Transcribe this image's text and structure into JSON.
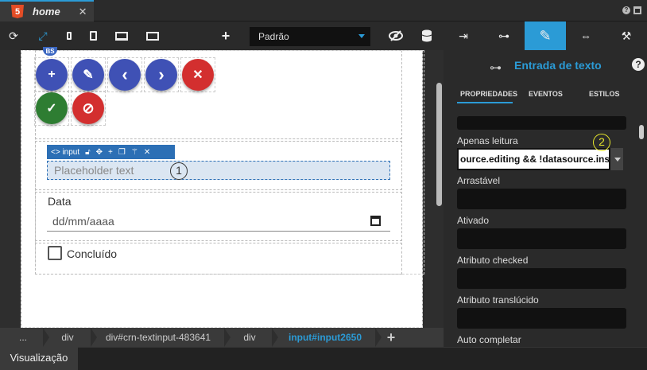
{
  "tab": {
    "title": "home",
    "icon": "html5-icon",
    "close": "✕"
  },
  "window": {
    "help": "?"
  },
  "toolbar": {
    "icons": [
      "refresh-icon",
      "expand-icon",
      "phone-icon",
      "tablet-icon",
      "desktop-icon",
      "monitor-icon",
      "plus-icon",
      "eye-slash-icon",
      "database-icon"
    ],
    "breakpoint_selected": "Padrão",
    "add_label": "+"
  },
  "canvas": {
    "bs_badge": "BS",
    "fab_buttons": [
      {
        "icon": "plus-icon",
        "glyph": "+",
        "color": "#3f51b5"
      },
      {
        "icon": "pencil-icon",
        "glyph": "✎",
        "color": "#3f51b5"
      },
      {
        "icon": "chevron-left-icon",
        "glyph": "‹",
        "color": "#3f51b5"
      },
      {
        "icon": "chevron-right-icon",
        "glyph": "›",
        "color": "#3f51b5"
      },
      {
        "icon": "close-icon",
        "glyph": "✕",
        "color": "#d32f2f"
      },
      {
        "icon": "check-icon",
        "glyph": "✓",
        "color": "#2e7d32"
      },
      {
        "icon": "block-icon",
        "glyph": "⊘",
        "color": "#d32f2f"
      }
    ],
    "input_toolbar": {
      "label": "<> input",
      "icons": [
        "unlock-icon",
        "move-icon",
        "add-icon",
        "copy-icon",
        "magic-icon",
        "remove-icon"
      ]
    },
    "text_input_placeholder": "Placeholder text",
    "marker_1": "1",
    "date_label": "Data",
    "date_placeholder": "dd/mm/aaaa",
    "checkbox_label": "Concluído"
  },
  "breadcrumb": {
    "items": [
      "...",
      "div",
      "div#crn-textinput-483641",
      "div",
      "input#input2650"
    ],
    "active_index": 4,
    "add": "+"
  },
  "bottom": {
    "view_button": "Visualização"
  },
  "panel": {
    "tabs": [
      "enter-icon",
      "tree-icon",
      "pencil-icon",
      "arrows-icon",
      "wand-icon"
    ],
    "active_tab_index": 2,
    "component_title": "Entrada de texto",
    "help": "?",
    "subtabs": [
      "PROPRIEDADES",
      "EVENTOS",
      "ESTILOS"
    ],
    "active_subtab": 0,
    "properties": [
      {
        "label": "Apenas leitura",
        "value": "ource.editing && !datasource.inserting"
      },
      {
        "label": "Arrastável",
        "value": ""
      },
      {
        "label": "Ativado",
        "value": ""
      },
      {
        "label": "Atributo checked",
        "value": ""
      },
      {
        "label": "Atributo translúcido",
        "value": ""
      },
      {
        "label": "Auto completar",
        "value": ""
      }
    ],
    "marker_2": "2"
  },
  "colors": {
    "accent": "#2b9bd6",
    "fab_blue": "#3f51b5",
    "fab_red": "#d32f2f",
    "fab_green": "#2e7d32",
    "marker_yellow": "#e6e62a"
  }
}
